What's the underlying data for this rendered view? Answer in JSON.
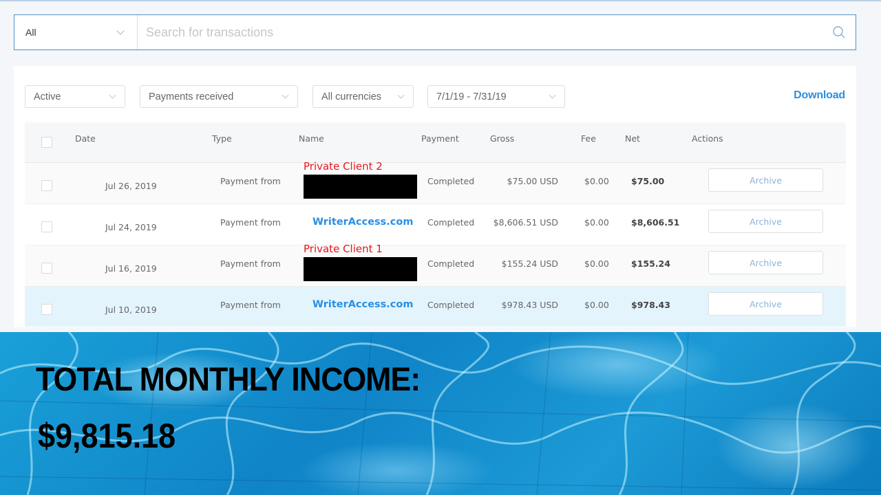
{
  "search": {
    "scope_value": "All",
    "placeholder": "Search for transactions"
  },
  "filters": {
    "status": "Active",
    "type": "Payments received",
    "currency": "All currencies",
    "date_range": "7/1/19 - 7/31/19",
    "download_label": "Download"
  },
  "table": {
    "headers": {
      "date": "Date",
      "type": "Type",
      "name": "Name",
      "payment": "Payment",
      "gross": "Gross",
      "fee": "Fee",
      "net": "Net",
      "actions": "Actions"
    },
    "rows": [
      {
        "date": "Jul 26, 2019",
        "type": "Payment from",
        "name": "",
        "annotation": "Private Client 2",
        "status": "Completed",
        "gross": "$75.00 USD",
        "fee": "$0.00",
        "net": "$75.00",
        "action": "Archive"
      },
      {
        "date": "Jul 24, 2019",
        "type": "Payment from",
        "name": "WriterAccess.com",
        "annotation": "",
        "status": "Completed",
        "gross": "$8,606.51 USD",
        "fee": "$0.00",
        "net": "$8,606.51",
        "action": "Archive"
      },
      {
        "date": "Jul 16, 2019",
        "type": "Payment from",
        "name": "",
        "annotation": "Private Client 1",
        "status": "Completed",
        "gross": "$155.24 USD",
        "fee": "$0.00",
        "net": "$155.24",
        "action": "Archive"
      },
      {
        "date": "Jul 10, 2019",
        "type": "Payment from",
        "name": "WriterAccess.com",
        "annotation": "",
        "status": "Completed",
        "gross": "$978.43 USD",
        "fee": "$0.00",
        "net": "$978.43",
        "action": "Archive"
      }
    ]
  },
  "banner": {
    "title": "TOTAL MONTHLY INCOME:",
    "amount": "$9,815.18"
  },
  "colors": {
    "accent": "#2a8fe3",
    "redaction_label": "#e8151b",
    "highlight_row": "#e4f4fd"
  }
}
